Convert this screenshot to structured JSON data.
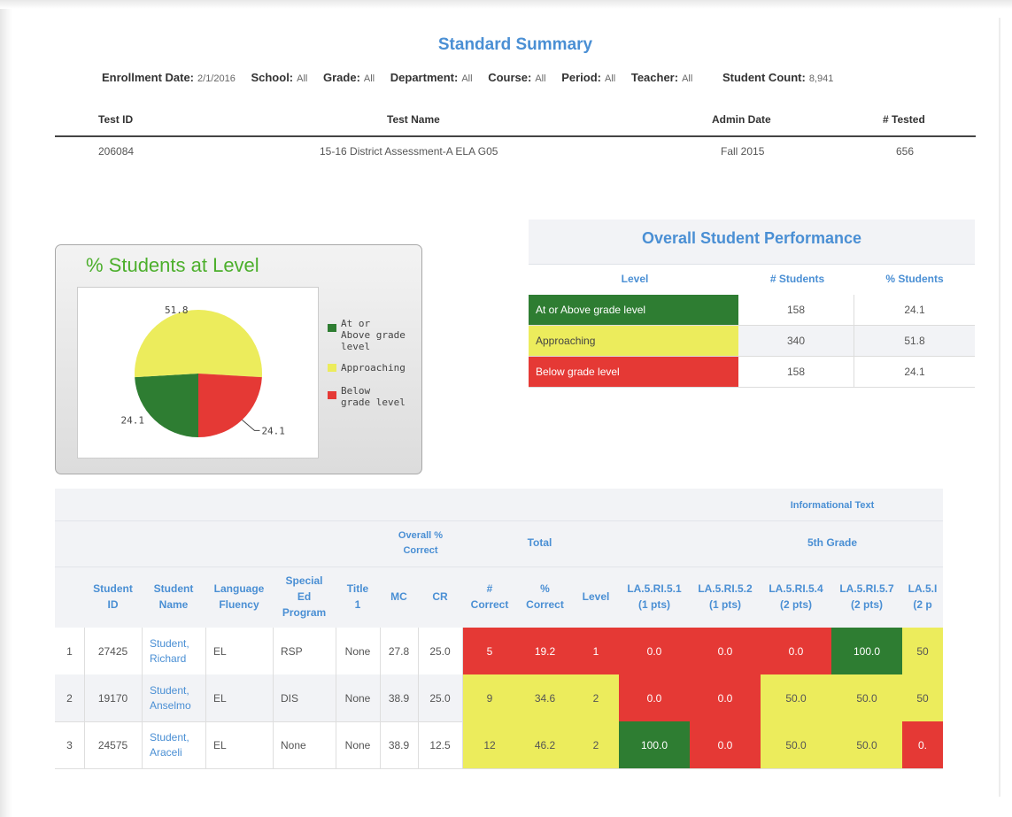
{
  "report": {
    "title": "Standard Summary",
    "filters": [
      {
        "label": "Enrollment Date:",
        "value": "2/1/2016"
      },
      {
        "label": "School:",
        "value": "All"
      },
      {
        "label": "Grade:",
        "value": "All"
      },
      {
        "label": "Department:",
        "value": "All"
      },
      {
        "label": "Course:",
        "value": "All"
      },
      {
        "label": "Period:",
        "value": "All"
      },
      {
        "label": "Teacher:",
        "value": "All"
      },
      {
        "label": "Student Count:",
        "value": "8,941"
      }
    ]
  },
  "test_table": {
    "headers": [
      "Test ID",
      "Test Name",
      "Admin Date",
      "# Tested"
    ],
    "row": [
      "206084",
      "15-16 District Assessment-A ELA G05",
      "Fall 2015",
      "656"
    ]
  },
  "chart_data": {
    "type": "pie",
    "title": "% Students at Level",
    "slices": [
      {
        "label": "At or Above grade level",
        "value": 24.1,
        "color": "#2e7d32"
      },
      {
        "label": "Approaching",
        "value": 51.8,
        "color": "#ecec5c"
      },
      {
        "label": "Below grade level",
        "value": 24.1,
        "color": "#e53935"
      }
    ],
    "data_labels": [
      "24.1",
      "51.8",
      "24.1"
    ],
    "legend": {
      "placement": "right",
      "items": [
        {
          "lines": [
            "At or",
            "Above grade",
            "level"
          ],
          "color": "#2e7d32"
        },
        {
          "lines": [
            "Approaching"
          ],
          "color": "#ecec5c"
        },
        {
          "lines": [
            "Below",
            "grade level"
          ],
          "color": "#e53935"
        }
      ]
    }
  },
  "performance": {
    "title": "Overall Student Performance",
    "headers": [
      "Level",
      "# Students",
      "% Students"
    ],
    "rows": [
      {
        "level": "At or Above grade level",
        "students": "158",
        "percent": "24.1",
        "bg": "#2e7d32",
        "fg": "#ffffff"
      },
      {
        "level": "Approaching",
        "students": "340",
        "percent": "51.8",
        "bg": "#ecec5c",
        "fg": "#444444"
      },
      {
        "level": "Below grade level",
        "students": "158",
        "percent": "24.1",
        "bg": "#e53935",
        "fg": "#ffffff"
      }
    ]
  },
  "student_table": {
    "group_informational": "Informational Text",
    "group_overall": [
      "Overall %",
      "Correct"
    ],
    "group_total": "Total",
    "group_grade": "5th Grade",
    "headers": [
      [
        "Student",
        "ID"
      ],
      [
        "Student",
        "Name"
      ],
      [
        "Language",
        "Fluency"
      ],
      [
        "Special",
        "Ed",
        "Program"
      ],
      [
        "Title",
        "1"
      ],
      [
        "MC"
      ],
      [
        "CR"
      ],
      [
        "#",
        "Correct"
      ],
      [
        "%",
        "Correct"
      ],
      [
        "Level"
      ],
      [
        "LA.5.RI.5.1",
        "(1 pts)"
      ],
      [
        "LA.5.RI.5.2",
        "(1 pts)"
      ],
      [
        "LA.5.RI.5.4",
        "(2 pts)"
      ],
      [
        "LA.5.RI.5.7",
        "(2 pts)"
      ],
      [
        "LA.5.I",
        "(2 p"
      ]
    ],
    "rows": [
      {
        "num": "1",
        "id": "27425",
        "name": [
          "Student,",
          "Richard"
        ],
        "fluency": "EL",
        "sped": "RSP",
        "title1": "None",
        "mc": "27.8",
        "cr": "25.0",
        "correct": "5",
        "pct": "19.2",
        "level": "1",
        "s1": "0.0",
        "s2": "0.0",
        "s4": "0.0",
        "s7": "100.0",
        "s8": "50"
      },
      {
        "num": "2",
        "id": "19170",
        "name": [
          "Student,",
          "Anselmo"
        ],
        "fluency": "EL",
        "sped": "DIS",
        "title1": "None",
        "mc": "38.9",
        "cr": "25.0",
        "correct": "9",
        "pct": "34.6",
        "level": "2",
        "s1": "0.0",
        "s2": "0.0",
        "s4": "50.0",
        "s7": "50.0",
        "s8": "50"
      },
      {
        "num": "3",
        "id": "24575",
        "name": [
          "Student,",
          "Araceli"
        ],
        "fluency": "EL",
        "sped": "None",
        "title1": "None",
        "mc": "38.9",
        "cr": "12.5",
        "correct": "12",
        "pct": "46.2",
        "level": "2",
        "s1": "100.0",
        "s2": "0.0",
        "s4": "50.0",
        "s7": "50.0",
        "s8": "0."
      }
    ],
    "colors": {
      "red": "#e53935",
      "yellow": "#ecec5c",
      "green": "#2e7d32",
      "header_blue": "#4a8fd4"
    }
  }
}
